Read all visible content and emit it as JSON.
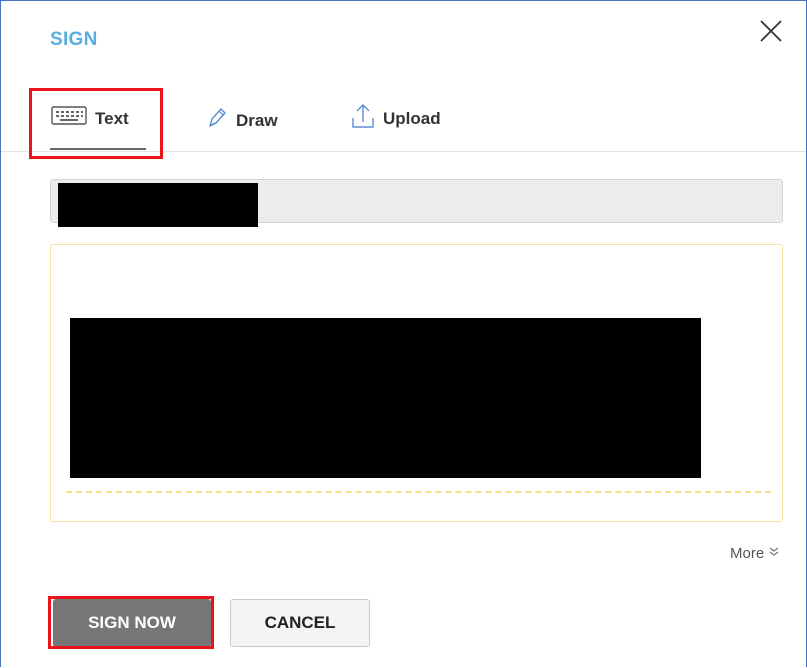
{
  "dialog": {
    "title": "SIGN",
    "close_icon": "close-icon"
  },
  "tabs": [
    {
      "label": "Text",
      "icon": "keyboard-icon",
      "active": true
    },
    {
      "label": "Draw",
      "icon": "pen-icon",
      "active": false
    },
    {
      "label": "Upload",
      "icon": "upload-icon",
      "active": false
    }
  ],
  "name_input": {
    "value": "",
    "redacted": true
  },
  "signature_preview": {
    "redacted": true
  },
  "more": {
    "label": "More",
    "icon": "double-chevron-down-icon"
  },
  "actions": {
    "sign_label": "SIGN NOW",
    "cancel_label": "CANCEL"
  },
  "colors": {
    "title": "#5aaee0",
    "highlight": "#e8141a",
    "primary_button": "#767676",
    "preview_border": "#f3e3a2"
  }
}
